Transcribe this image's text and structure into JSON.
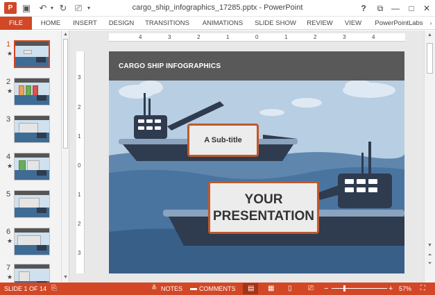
{
  "window": {
    "title": "cargo_ship_infographics_17285.pptx - PowerPoint",
    "help": "?",
    "restore": "⧉",
    "minimize": "—",
    "maximize": "□",
    "close": "✕"
  },
  "ribbon": {
    "tabs": [
      "FILE",
      "HOME",
      "INSERT",
      "DESIGN",
      "TRANSITIONS",
      "ANIMATIONS",
      "SLIDE SHOW",
      "REVIEW",
      "VIEW",
      "PowerPointLabs"
    ]
  },
  "thumbnails": [
    {
      "number": "1",
      "star": "★",
      "active": true
    },
    {
      "number": "2",
      "star": "★",
      "active": false
    },
    {
      "number": "3",
      "star": "",
      "active": false
    },
    {
      "number": "4",
      "star": "★",
      "active": false
    },
    {
      "number": "5",
      "star": "",
      "active": false
    },
    {
      "number": "6",
      "star": "★",
      "active": false
    },
    {
      "number": "7",
      "star": "★",
      "active": false
    }
  ],
  "ruler": {
    "h_labels": [
      "4",
      "3",
      "2",
      "1",
      "0",
      "1",
      "2",
      "3",
      "4"
    ],
    "v_labels": [
      "3",
      "2",
      "1",
      "0",
      "1",
      "2",
      "3"
    ]
  },
  "slide": {
    "header_title": "CARGO SHIP INFOGRAPHICS",
    "subtitle": "A Sub-title",
    "main_line1": "YOUR",
    "main_line2": "PRESENTATION"
  },
  "status": {
    "slide_info": "SLIDE 1 OF 14",
    "notes": "NOTES",
    "comments": "COMMENTS",
    "zoom_minus": "−",
    "zoom_plus": "+",
    "zoom": "57%"
  },
  "colors": {
    "accent": "#d24726",
    "header": "#595959",
    "sky": "#b7cee3",
    "sea": "#3f6c94",
    "ship": "#2f3b4f",
    "callout_border": "#c0582a"
  }
}
